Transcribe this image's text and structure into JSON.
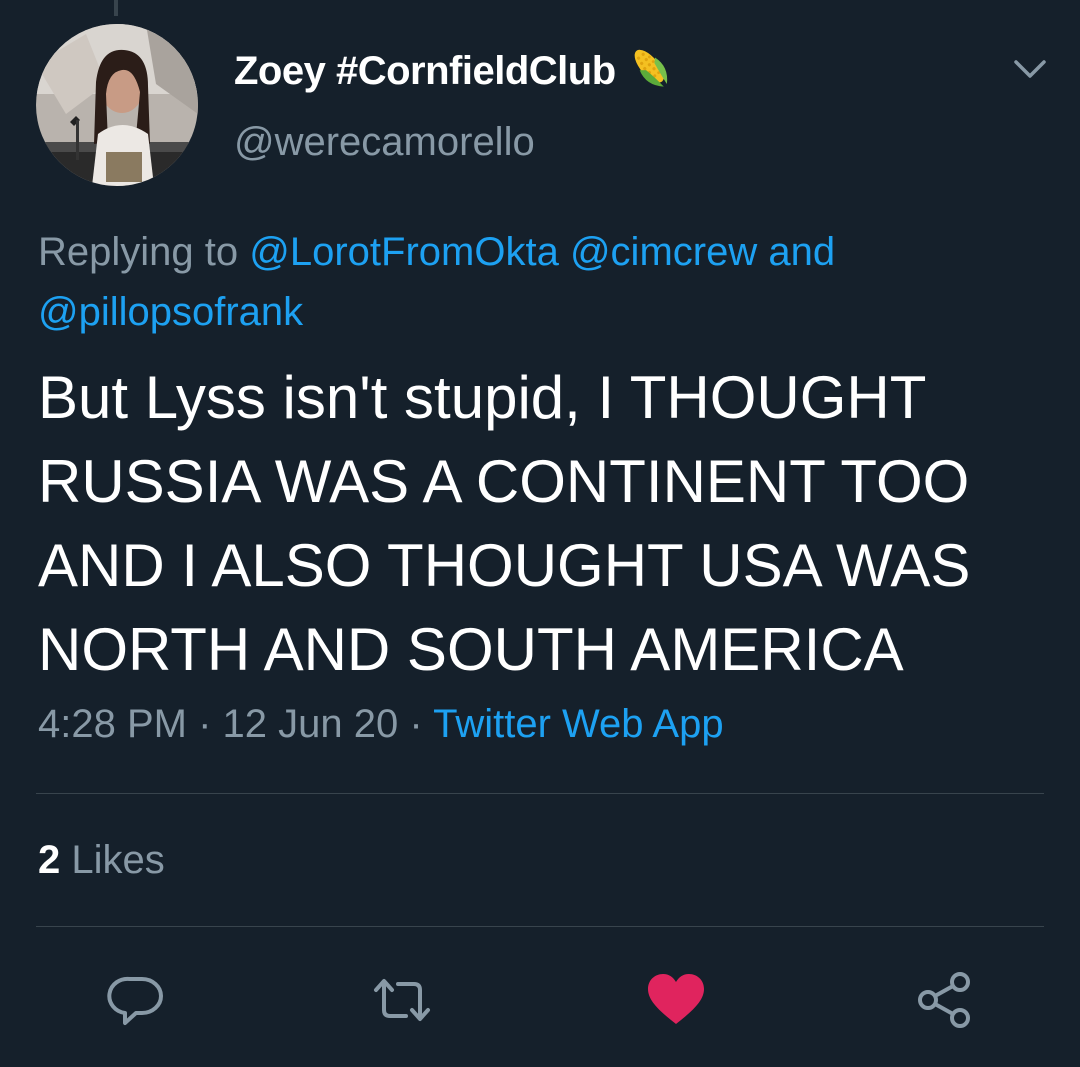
{
  "tweet": {
    "display_name": "Zoey #CornfieldClub",
    "name_emoji": "corn-emoji",
    "handle": "@werecamorello",
    "replying_prefix": "Replying to",
    "replying_mentions": [
      "@LorotFromOkta",
      "@cimcrew"
    ],
    "replying_joiner": "and",
    "replying_last": "@pillopsofrank",
    "text": "But Lyss isn't stupid, I THOUGHT RUSSIA WAS A CONTINENT TOO AND I ALSO THOUGHT USA WAS NORTH AND SOUTH AMERICA",
    "time": "4:28 PM",
    "separator": "·",
    "date": "12 Jun 20",
    "source": "Twitter Web App",
    "likes_count": "2",
    "likes_label": "Likes"
  },
  "actions": [
    {
      "icon": "reply-icon",
      "color": "#8899a6"
    },
    {
      "icon": "retweet-icon",
      "color": "#8899a6"
    },
    {
      "icon": "heart-icon",
      "color": "#e0245e"
    },
    {
      "icon": "share-icon",
      "color": "#8899a6"
    }
  ],
  "colors": {
    "background": "#15202b",
    "text": "#ffffff",
    "secondary": "#8899a6",
    "link": "#1da1f2",
    "like": "#e0245e",
    "divider": "#38444d"
  }
}
